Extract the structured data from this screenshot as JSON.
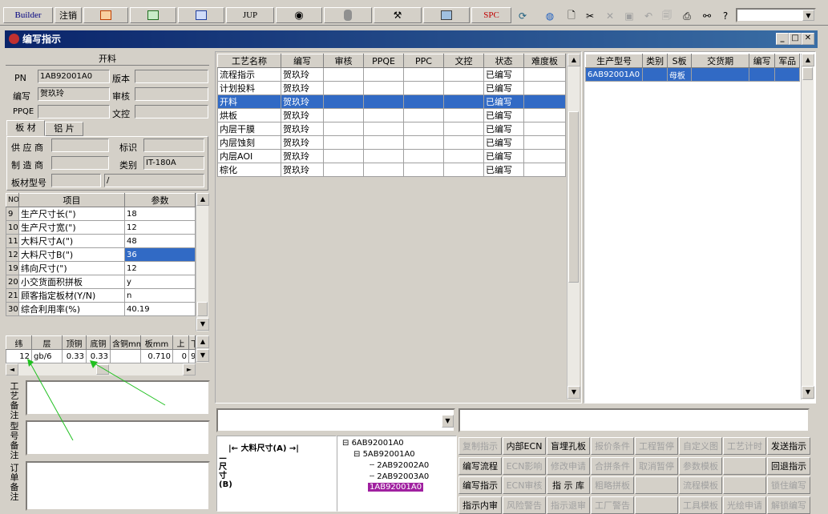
{
  "toolbar": {
    "builder_label": "Builder",
    "logout_label": "注销",
    "jup_label": "JUP",
    "spc_label": "SPC"
  },
  "window": {
    "title": "编写指示"
  },
  "left": {
    "section_title": "开料",
    "pn_label": "PN",
    "pn_value": "1AB92001A0",
    "version_label": "版本",
    "version_value": "",
    "writer_label": "编写",
    "writer_value": "贺玖玲",
    "review_label": "审核",
    "review_value": "",
    "ppqe_label": "PPQE",
    "ppqe_value": "",
    "control_label": "文控",
    "control_value": "",
    "tab_sheet": "板 材",
    "tab_copper": "铝 片",
    "supplier_label": "供 应 商",
    "supplier_value": "",
    "mark_label": "标识",
    "mark_value": "",
    "maker_label": "制 造 商",
    "maker_value": "",
    "category_label": "类别",
    "category_value": "IT-180A",
    "sheet_model_label": "板材型号",
    "sheet_model_value": "",
    "sheet_model_value2": "/",
    "param_headers": [
      "NO",
      "项目",
      "参数"
    ],
    "params": [
      {
        "no": "9",
        "item": "生产尺寸长(\")",
        "value": "18"
      },
      {
        "no": "10",
        "item": "生产尺寸宽(\")",
        "value": "12"
      },
      {
        "no": "11",
        "item": "大料尺寸A(\")",
        "value": "48"
      },
      {
        "no": "12",
        "item": "大料尺寸B(\")",
        "value": "36"
      },
      {
        "no": "19",
        "item": "纬向尺寸(\")",
        "value": "12"
      },
      {
        "no": "20",
        "item": "小交货面积拼板",
        "value": "y"
      },
      {
        "no": "21",
        "item": "顾客指定板材(Y/N)",
        "value": "n"
      },
      {
        "no": "30",
        "item": "综合利用率(%)",
        "value": "40.19"
      }
    ],
    "layer_headers": [
      "纬",
      "层",
      "顶铜",
      "底铜",
      "含铜mm",
      "板mm",
      "上",
      "下"
    ],
    "layer_row": [
      "12",
      "gb/6",
      "0.33",
      "0.33",
      "",
      "0.710",
      "0",
      "9"
    ],
    "process_note_label": "工艺备注",
    "model_note_label": "型号备注",
    "order_note_label": "订单备注"
  },
  "process": {
    "headers": [
      "工艺名称",
      "编写",
      "审核",
      "PPQE",
      "PPC",
      "文控",
      "状态",
      "难度板"
    ],
    "rows": [
      [
        "流程指示",
        "贺玖玲",
        "",
        "",
        "",
        "",
        "已编写",
        ""
      ],
      [
        "计划投料",
        "贺玖玲",
        "",
        "",
        "",
        "",
        "已编写",
        ""
      ],
      [
        "开料",
        "贺玖玲",
        "",
        "",
        "",
        "",
        "已编写",
        ""
      ],
      [
        "烘板",
        "贺玖玲",
        "",
        "",
        "",
        "",
        "已编写",
        ""
      ],
      [
        "内层干膜",
        "贺玖玲",
        "",
        "",
        "",
        "",
        "已编写",
        ""
      ],
      [
        "内层蚀刻",
        "贺玖玲",
        "",
        "",
        "",
        "",
        "已编写",
        ""
      ],
      [
        "内层AOI",
        "贺玖玲",
        "",
        "",
        "",
        "",
        "已编写",
        ""
      ],
      [
        "棕化",
        "贺玖玲",
        "",
        "",
        "",
        "",
        "已编写",
        ""
      ]
    ]
  },
  "model": {
    "headers": [
      "生产型号",
      "类别",
      "S板",
      "交货期",
      "编写",
      "军品"
    ],
    "row": [
      "6AB92001A0",
      "",
      "母板",
      "",
      "",
      ""
    ]
  },
  "drawing": {
    "dim_a": "大料尺寸(A)",
    "dim_b": "尺寸(B)"
  },
  "tree": {
    "root": "6AB92001A0",
    "child": "5AB92001A0",
    "leaf1": "2AB92002A0",
    "leaf2": "2AB92003A0",
    "selected": "1AB92001A0"
  },
  "actions": {
    "row1": [
      "复制指示",
      "内部ECN",
      "盲埋孔板",
      "报价条件",
      "工程暂停",
      "自定义图",
      "工艺计时",
      "发送指示"
    ],
    "row2": [
      "编写流程",
      "ECN影响",
      "修改申请",
      "合拼条件",
      "取消暂停",
      "参数模板",
      "",
      "回退指示"
    ],
    "row3": [
      "编写指示",
      "ECN审核",
      "指 示 库",
      "粗略拼板",
      "",
      "流程模板",
      "",
      "锁住编写"
    ],
    "row4": [
      "指示内审",
      "风险警告",
      "指示退审",
      "工厂警告",
      "",
      "工具模板",
      "光绘申请",
      "解锁编写"
    ]
  }
}
